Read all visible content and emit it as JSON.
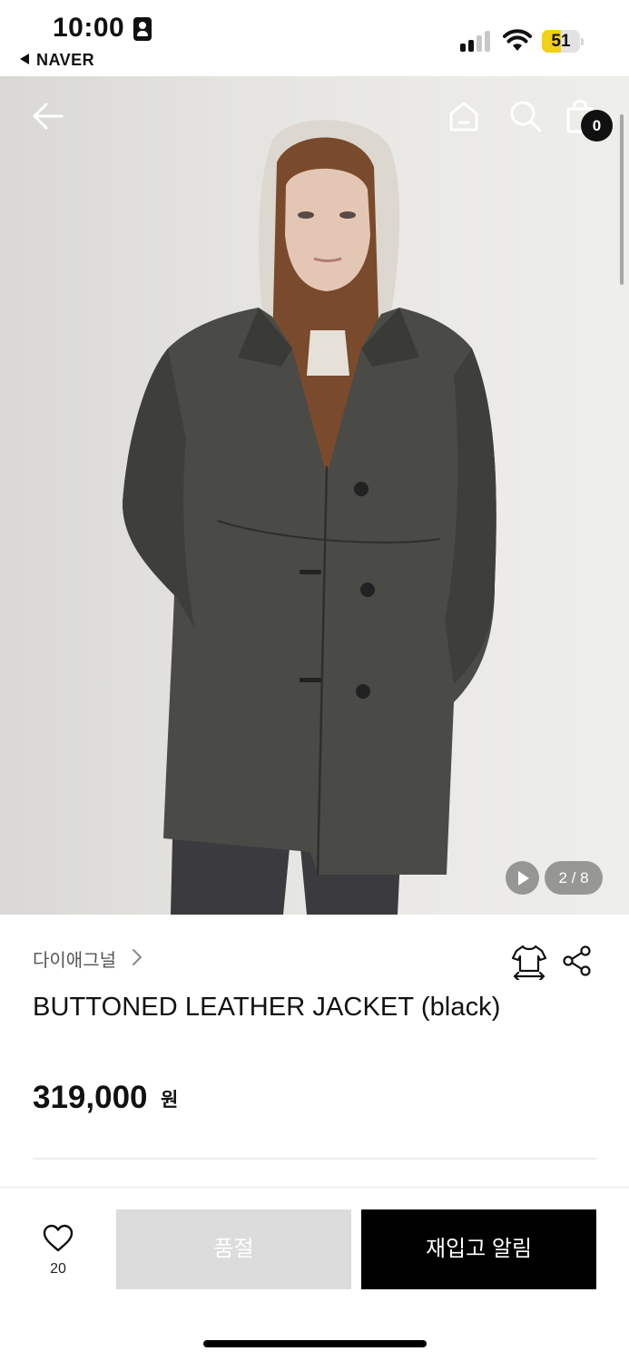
{
  "status_bar": {
    "time": "10:00",
    "back_app": "NAVER",
    "battery_level": "51",
    "battery_fraction": 0.51,
    "signal_bars_active": 2,
    "signal_bars_total": 4
  },
  "nav": {
    "cart_count": "0",
    "icons": [
      "back-arrow-icon",
      "home-icon",
      "search-icon",
      "shopping-bag-icon"
    ]
  },
  "gallery": {
    "counter": "2 / 8",
    "current": 2,
    "total": 8
  },
  "product": {
    "brand": "다이애그널",
    "title": "BUTTONED LEATHER JACKET (black)",
    "price": "319,000",
    "currency": "원"
  },
  "actions": {
    "like_count": "20",
    "soldout_label": "품절",
    "restock_label": "재입고 알림"
  },
  "colors": {
    "primary_button": "#000000",
    "disabled_button": "#dcdcdc",
    "battery": "#f2d116"
  }
}
